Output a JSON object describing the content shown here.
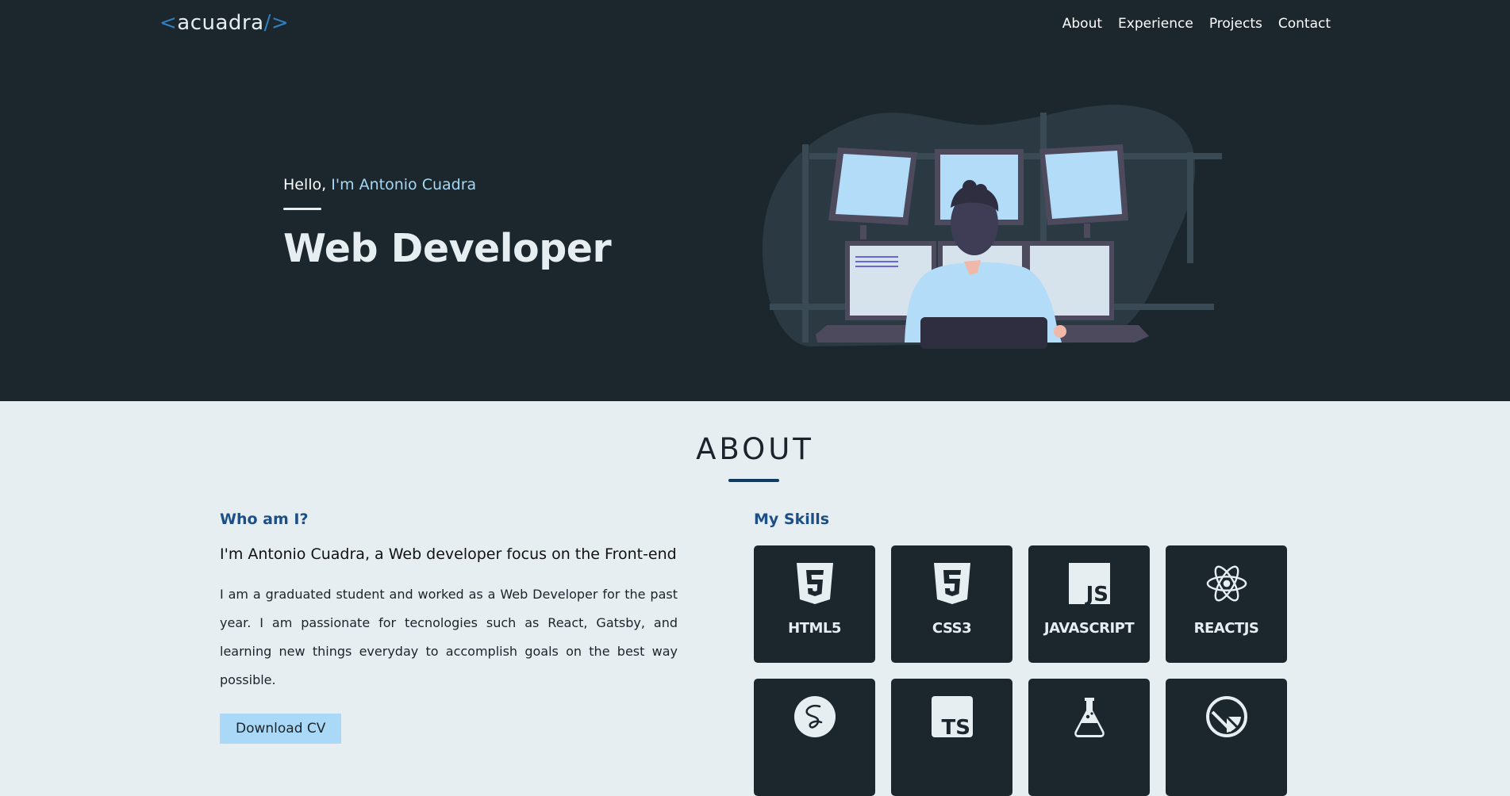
{
  "header": {
    "logo_open": "<",
    "logo_text": "acuadra",
    "logo_close": "/>",
    "nav": [
      "About",
      "Experience",
      "Projects",
      "Contact"
    ]
  },
  "hero": {
    "greeting": "Hello,",
    "name": "I'm Antonio Cuadra",
    "role": "Web Developer"
  },
  "about": {
    "title": "ABOUT",
    "who_title": "Who am I?",
    "lead": "I'm Antonio Cuadra, a Web developer focus on the Front-end",
    "paragraph": "I am a graduated student and worked as a Web Developer for the past year. I am passionate for tecnologies such as React, Gatsby, and learning new things everyday to accomplish goals on the best way possible.",
    "cv_label": "Download CV",
    "skills_title": "My Skills",
    "skills": [
      {
        "label": "HTML5",
        "icon": "html5-icon"
      },
      {
        "label": "CSS3",
        "icon": "css3-icon"
      },
      {
        "label": "JAVASCRIPT",
        "icon": "javascript-icon"
      },
      {
        "label": "REACTJS",
        "icon": "react-icon"
      },
      {
        "label": "",
        "icon": "sass-icon"
      },
      {
        "label": "",
        "icon": "typescript-icon"
      },
      {
        "label": "",
        "icon": "flask-icon"
      },
      {
        "label": "",
        "icon": "gatsby-icon"
      }
    ]
  },
  "colors": {
    "hero_bg": "#1b262d",
    "page_bg": "#e6eef1",
    "accent": "#aad9f7",
    "heading_blue": "#1d4f86"
  }
}
